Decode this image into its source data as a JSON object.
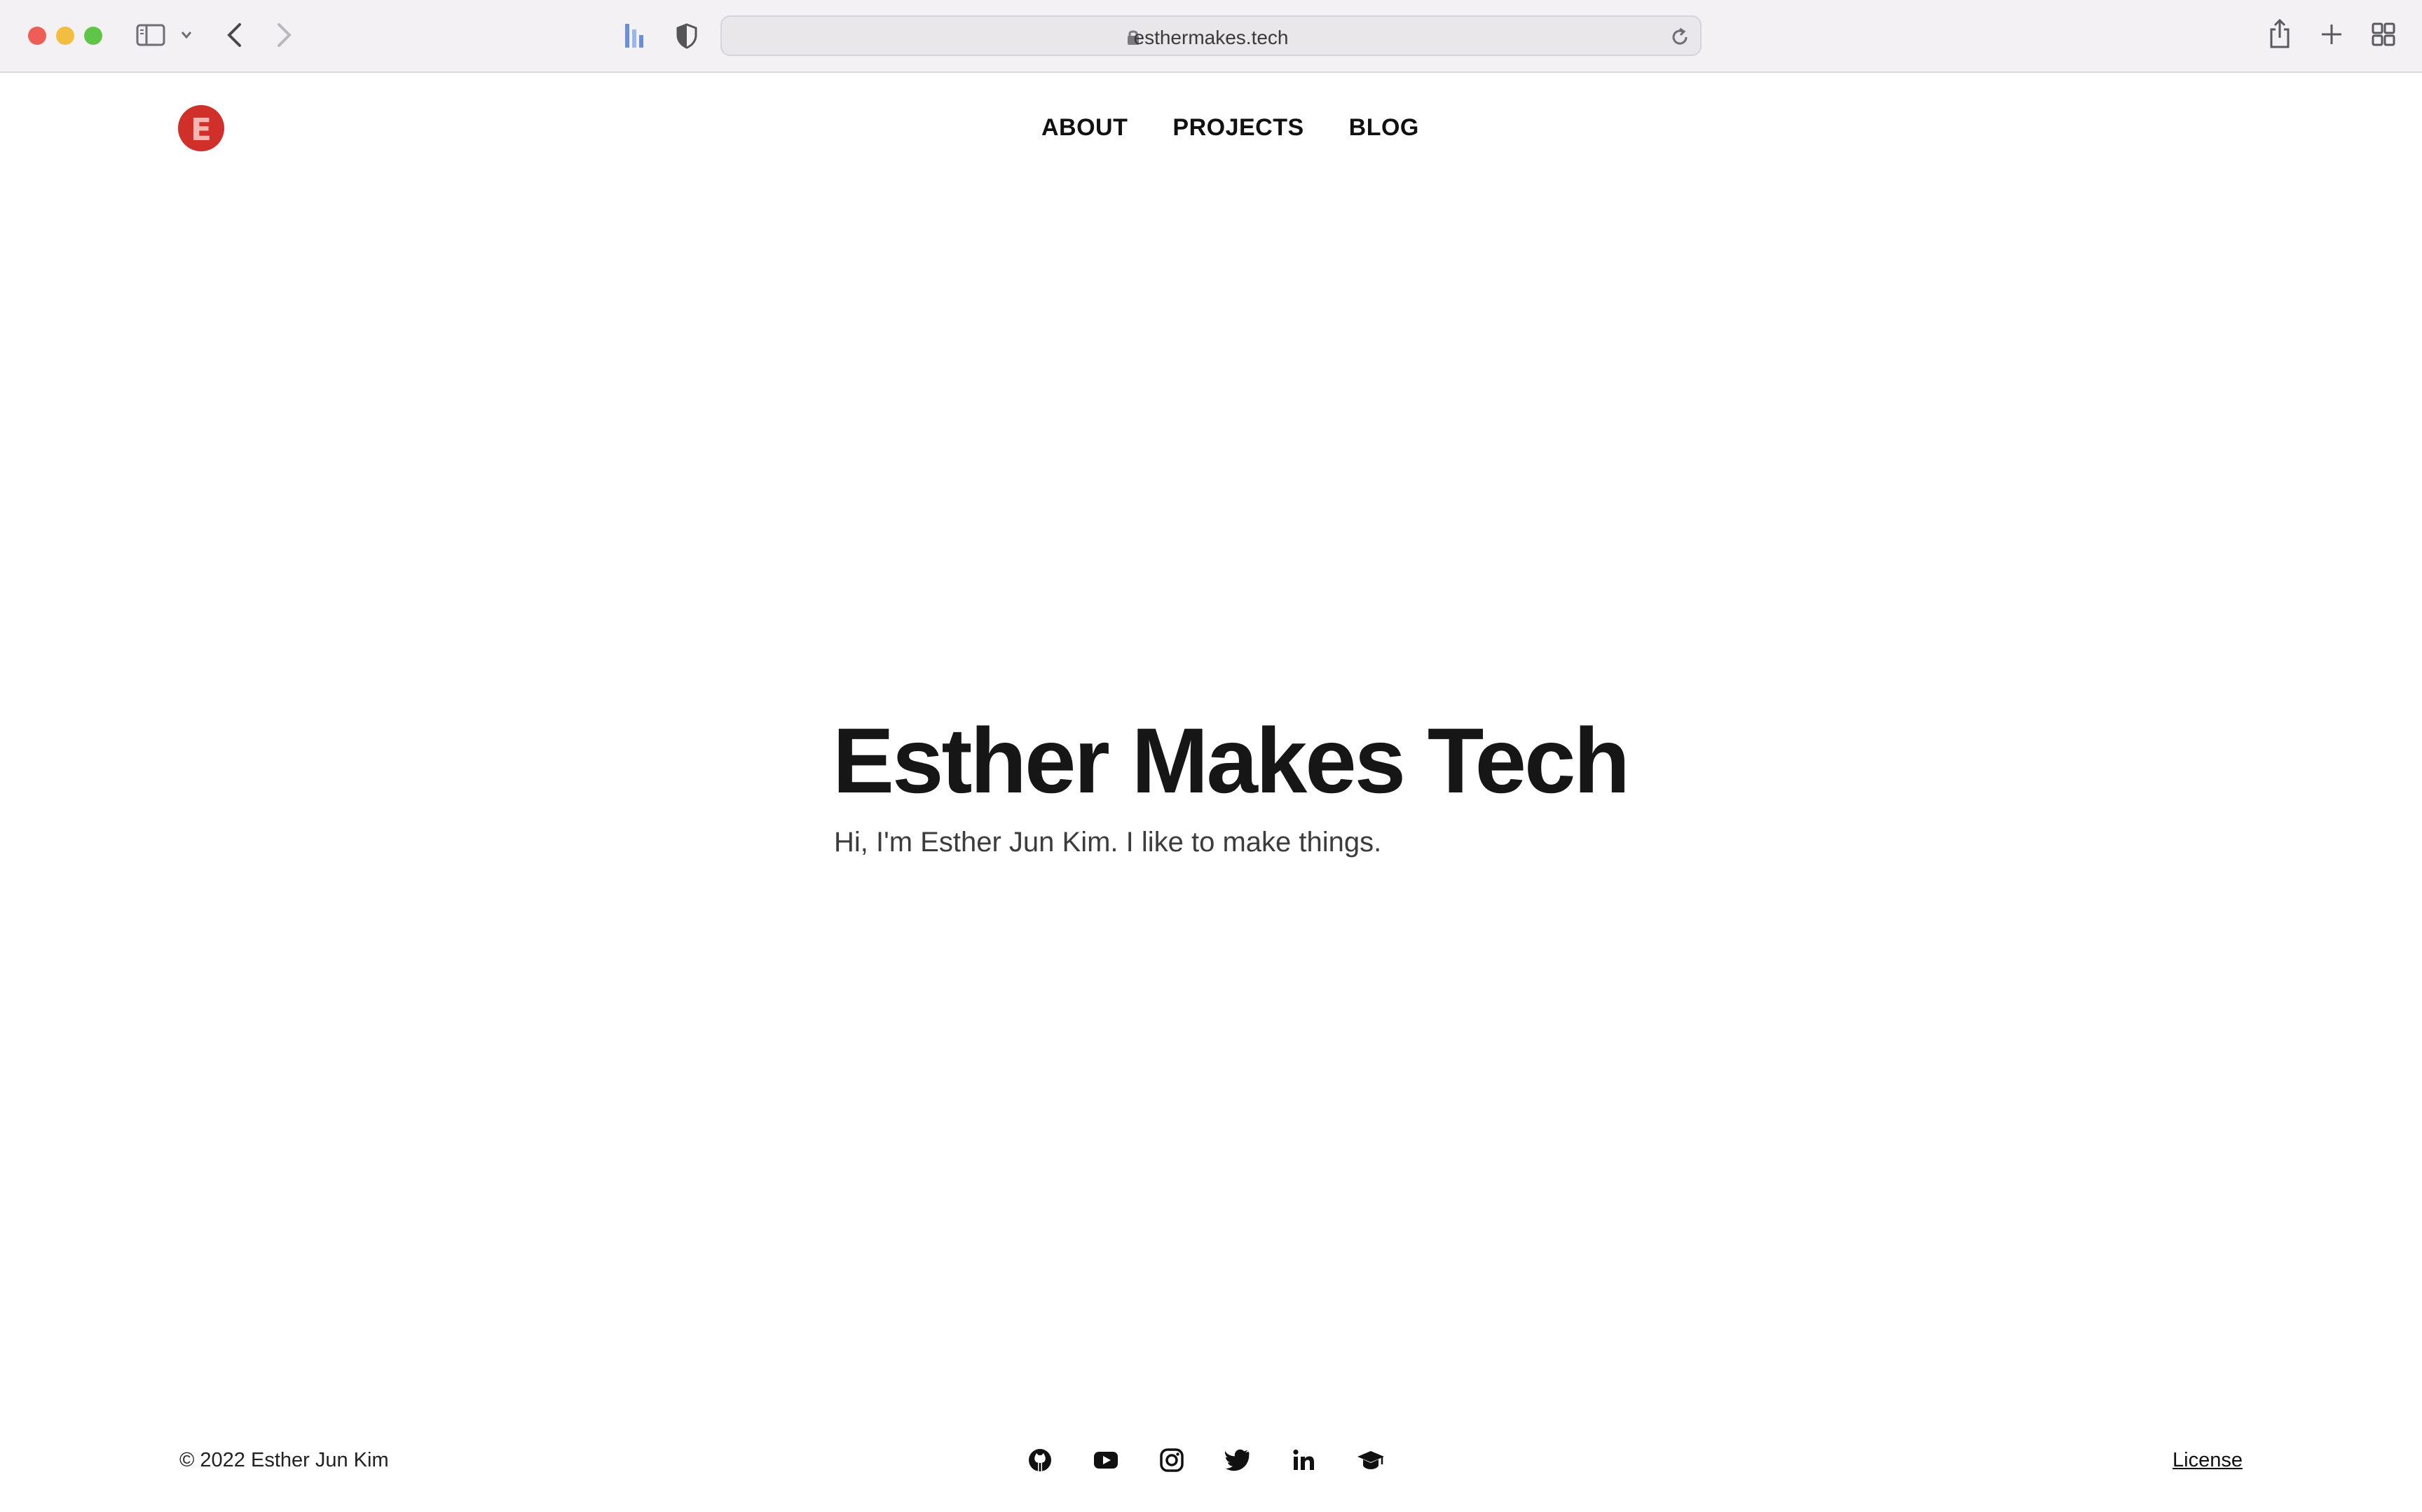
{
  "browser": {
    "url": "esthermakes.tech",
    "icons": [
      "sidebar-icon",
      "chevron-down-icon",
      "back-icon",
      "forward-icon",
      "extension-icon",
      "shield-icon",
      "lock-icon",
      "reload-icon",
      "share-icon",
      "new-tab-icon",
      "tab-overview-icon"
    ]
  },
  "site": {
    "logo_letter": "E",
    "brand_color": "#d12f2a",
    "nav": [
      "ABOUT",
      "PROJECTS",
      "BLOG"
    ]
  },
  "hero": {
    "title": "Esther Makes Tech",
    "subtitle": "Hi, I'm Esther Jun Kim. I like to make things."
  },
  "footer": {
    "copyright": "© 2022 Esther Jun Kim",
    "license": "License",
    "social_icons": [
      "github-icon",
      "youtube-icon",
      "instagram-icon",
      "twitter-icon",
      "linkedin-icon",
      "graduation-cap-icon"
    ]
  }
}
